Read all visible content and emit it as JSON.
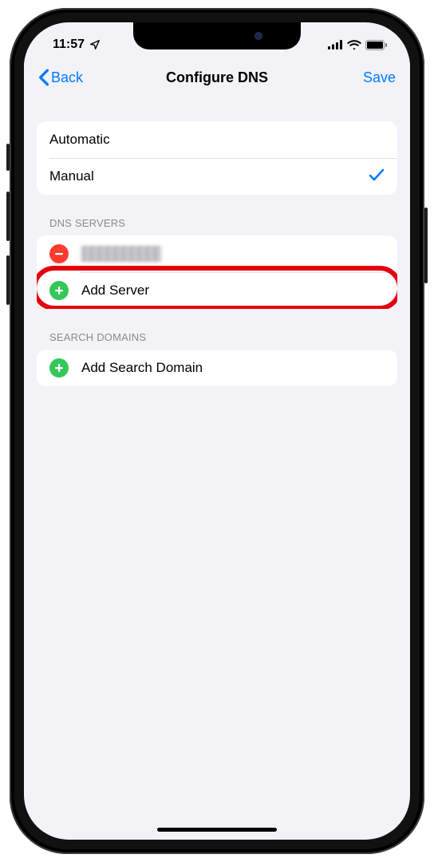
{
  "statusbar": {
    "time": "11:57",
    "location_icon": "location-arrow"
  },
  "nav": {
    "back_label": "Back",
    "title": "Configure DNS",
    "save_label": "Save"
  },
  "mode_group": {
    "options": [
      {
        "label": "Automatic",
        "selected": false
      },
      {
        "label": "Manual",
        "selected": true
      }
    ]
  },
  "dns_servers": {
    "header": "DNS SERVERS",
    "rows": [
      {
        "type": "remove",
        "label_redacted": true
      },
      {
        "type": "add",
        "label": "Add Server",
        "highlighted": true
      }
    ]
  },
  "search_domains": {
    "header": "SEARCH DOMAINS",
    "rows": [
      {
        "type": "add",
        "label": "Add Search Domain"
      }
    ]
  }
}
